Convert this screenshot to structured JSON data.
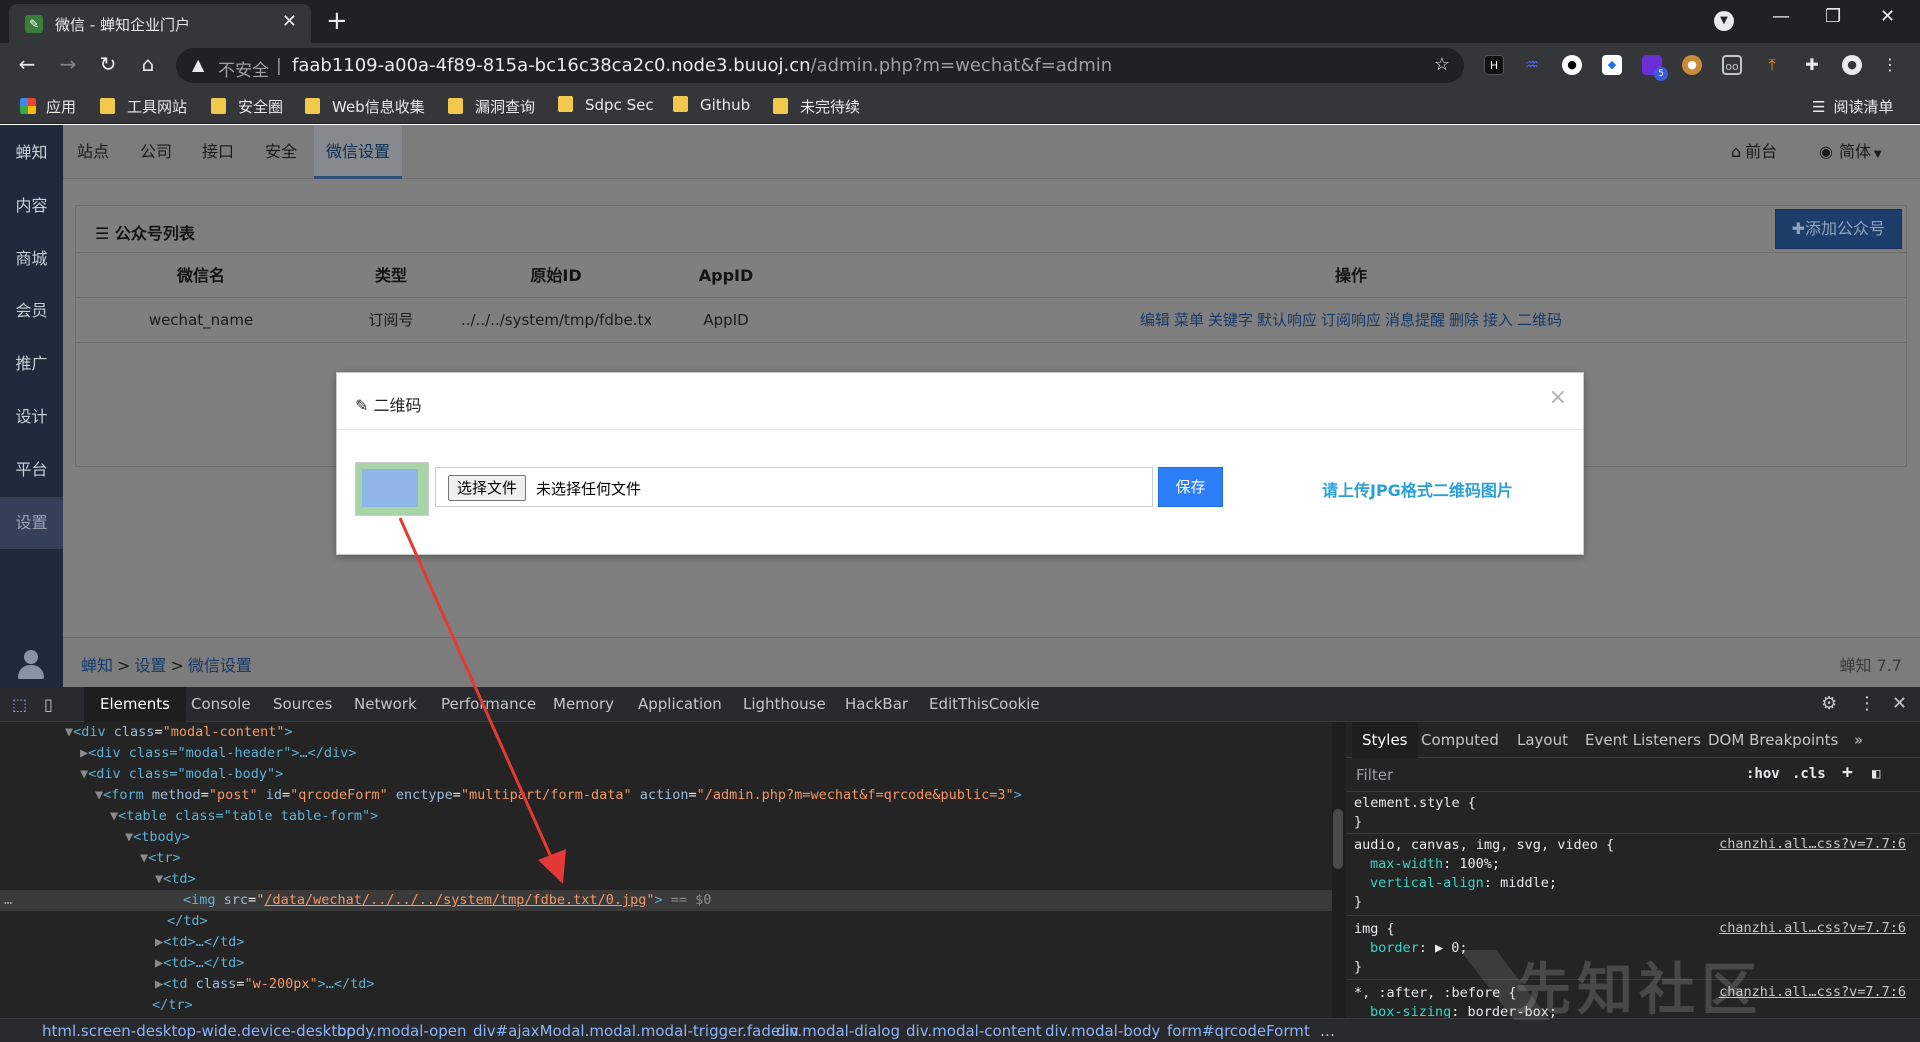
{
  "browser": {
    "tab_title": "微信 - 蝉知企业门户",
    "url_insecure_label": "不安全",
    "url_separator": "|",
    "url_host": "faab1109-a00a-4f89-815a-bc16c38ca2c0.node3.buuoj.cn",
    "url_path": "/admin.php?m=wechat&f=admin",
    "extension_badge": "5",
    "bookmarks": [
      "应用",
      "工具网站",
      "安全圈",
      "Web信息收集",
      "漏洞查询",
      "Sdpc Sec",
      "Github",
      "未完待续"
    ],
    "reading_list": "阅读清单"
  },
  "sidebar": {
    "items": [
      "蝉知",
      "内容",
      "商城",
      "会员",
      "推广",
      "设计",
      "平台",
      "设置"
    ]
  },
  "topnav": {
    "items": [
      "站点",
      "公司",
      "接口",
      "安全",
      "微信设置"
    ],
    "frontend": "前台",
    "language": "简体"
  },
  "panel": {
    "title": "公众号列表",
    "add_button": "添加公众号",
    "columns": [
      "微信名",
      "类型",
      "原始ID",
      "AppID",
      "操作"
    ],
    "rows": [
      {
        "name": "wechat_name",
        "type": "订阅号",
        "original_id": "../../../system/tmp/fdbe.txt/(",
        "appid": "AppID",
        "actions": [
          "编辑",
          "菜单",
          "关键字",
          "默认响应",
          "订阅响应",
          "消息提醒",
          "删除",
          "接入",
          "二维码"
        ]
      }
    ]
  },
  "footer": {
    "crumbs": [
      "蝉知",
      "设置",
      "微信设置"
    ],
    "crumb_sep": ">",
    "version": "蝉知 7.7"
  },
  "modal": {
    "title": "二维码",
    "close": "×",
    "choose_file": "选择文件",
    "no_file": "未选择任何文件",
    "save": "保存",
    "hint": "请上传JPG格式二维码图片"
  },
  "devtools": {
    "tabs": [
      "Elements",
      "Console",
      "Sources",
      "Network",
      "Performance",
      "Memory",
      "Application",
      "Lighthouse",
      "HackBar",
      "EditThisCookie"
    ],
    "dom_lines": [
      {
        "indent": 0,
        "arrow": "▼",
        "html": "<span class='tg'>&lt;div</span> <span class='an'>class</span>=<span class='av'>\"modal-content\"</span><span class='tg'>&gt;</span>"
      }
    ],
    "dom": {
      "l1_tag": "<div",
      "l1_attr": "class",
      "l1_val": "\"modal-content\"",
      "l2": "<div class=\"modal-header\">…</div>",
      "l3": "<div class=\"modal-body\">",
      "l4_form": "<form",
      "l4_method": "\"post\"",
      "l4_id": "\"qrcodeForm\"",
      "l4_enctype": "\"multipart/form-data\"",
      "l4_action": "\"/admin.php?m=wechat&f=qrcode&public=3\"",
      "l5": "<table class=\"table table-form\">",
      "l6": "<tbody>",
      "l7": "<tr>",
      "l8": "<td>",
      "l9_src": "/data/wechat/../../../system/tmp/fdbe.txt/0.jpg",
      "l9_eq": "== $0",
      "l10": "</td>",
      "l11": "<td>…</td>",
      "l12": "<td>…</td>",
      "l13_val": "\"w-200px\"",
      "l14": "</tr>"
    },
    "styles_tabs": [
      "Styles",
      "Computed",
      "Layout",
      "Event Listeners",
      "DOM Breakpoints"
    ],
    "filter_placeholder": "Filter",
    "hov": ":hov",
    ".cls": ".cls",
    "rules": {
      "r1_sel": "element.style {",
      "r2_sel": "audio, canvas, img, svg, video {",
      "r2_src": "chanzhi.all…css?v=7.7:6",
      "r2_p1": "max-width",
      "r2_v1": "100%;",
      "r2_p2": "vertical-align",
      "r2_v2": "middle;",
      "r3_sel": "img {",
      "r3_src": "chanzhi.all…css?v=7.7:6",
      "r3_p1": "border",
      "r3_v1": "0;",
      "r4_sel": "*, :after, :before {",
      "r4_src": "chanzhi.all…css?v=7.7:6",
      "r4_p1": "box-sizing",
      "r4_v1": "border-box;",
      "close": "}"
    },
    "crumbs": [
      "html.screen-desktop-wide.device-desktop",
      "body.modal-open",
      "div#ajaxModal.modal.modal-trigger.fade.in",
      "div.modal-dialog",
      "div.modal-content",
      "div.modal-body",
      "form#qrcodeForm",
      "t"
    ]
  },
  "watermark": "先知社区",
  "colors": {
    "accent": "#2d7ff9",
    "hint": "#2a9fd8",
    "arrow": "#e53935"
  }
}
